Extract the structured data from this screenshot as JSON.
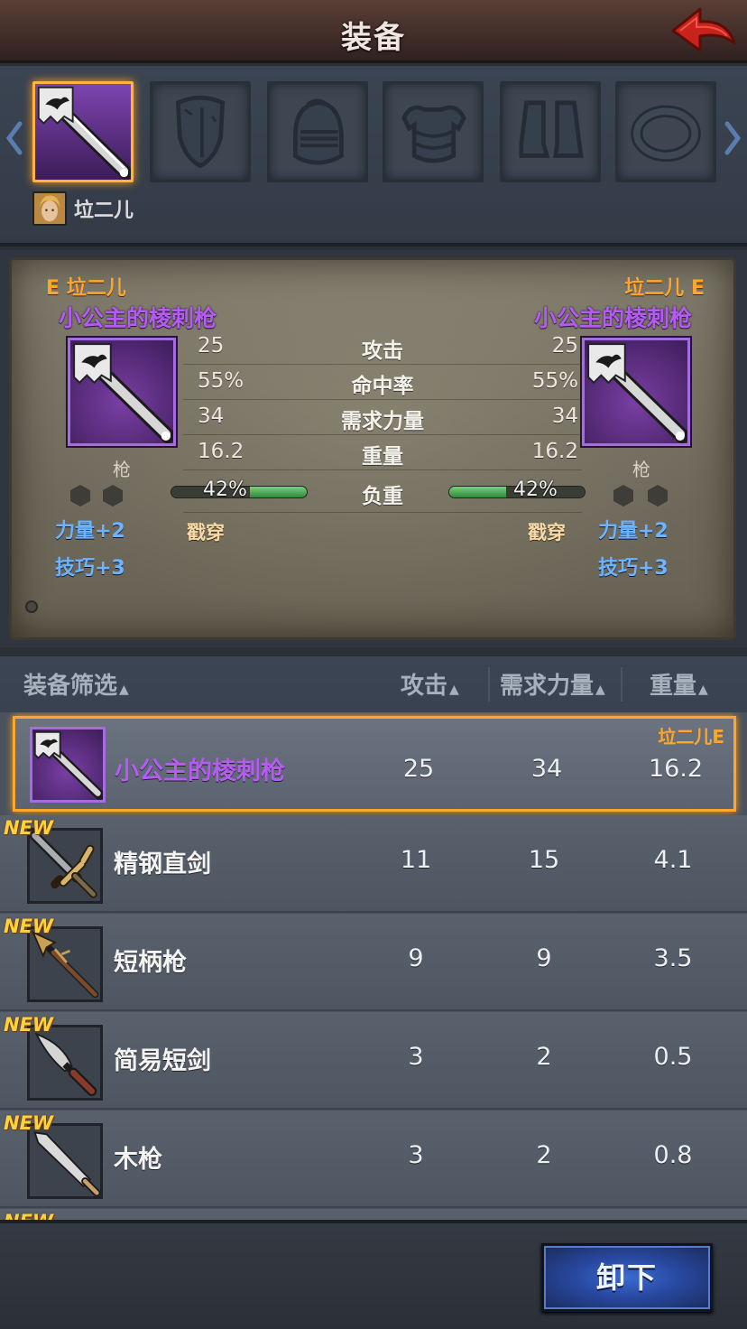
{
  "header": {
    "title": "装备"
  },
  "owner": {
    "name": "垃二儿"
  },
  "slots": [
    {
      "icon": "spear-icon",
      "active": true
    },
    {
      "icon": "shield-icon",
      "active": false
    },
    {
      "icon": "helmet-icon",
      "active": false
    },
    {
      "icon": "armor-icon",
      "active": false
    },
    {
      "icon": "boots-icon",
      "active": false
    },
    {
      "icon": "ring-icon",
      "active": false
    }
  ],
  "compare": {
    "left": {
      "owner": "E 垃二儿",
      "name": "小公主的棱刺枪",
      "type": "枪",
      "bonuses": [
        "力量+2",
        "技巧+3"
      ],
      "trait": "戳穿"
    },
    "right": {
      "owner": "垃二儿 E",
      "name": "小公主的棱刺枪",
      "type": "枪",
      "bonuses": [
        "力量+2",
        "技巧+3"
      ],
      "trait": "戳穿"
    },
    "stats": [
      {
        "label": "攻击",
        "left": "25",
        "right": "25"
      },
      {
        "label": "命中率",
        "left": "55%",
        "right": "55%"
      },
      {
        "label": "需求力量",
        "left": "34",
        "right": "34"
      },
      {
        "label": "重量",
        "left": "16.2",
        "right": "16.2"
      }
    ],
    "load": {
      "label": "负重",
      "left": "42%",
      "right": "42%",
      "left_fraction": 0.42,
      "right_fraction": 0.42
    }
  },
  "filter": {
    "label": "装备筛选",
    "col_attack": "攻击",
    "col_strength": "需求力量",
    "col_weight": "重量"
  },
  "items": [
    {
      "name": "小公主的棱刺枪",
      "attack": "25",
      "strength": "34",
      "weight": "16.2",
      "equipped_by": "垃二儿E",
      "selected": true,
      "new": false,
      "icon": "spear-icon"
    },
    {
      "name": "精钢直剑",
      "attack": "11",
      "strength": "15",
      "weight": "4.1",
      "new_label": "NEW",
      "icon": "sword-icon"
    },
    {
      "name": "短柄枪",
      "attack": "9",
      "strength": "9",
      "weight": "3.5",
      "new_label": "NEW",
      "icon": "short-spear-icon"
    },
    {
      "name": "简易短剑",
      "attack": "3",
      "strength": "2",
      "weight": "0.5",
      "new_label": "NEW",
      "icon": "dagger-icon"
    },
    {
      "name": "木枪",
      "attack": "3",
      "strength": "2",
      "weight": "0.8",
      "new_label": "NEW",
      "icon": "wooden-spear-icon"
    }
  ],
  "partial_new_label": "NEW",
  "footer": {
    "unequip_label": "卸下"
  },
  "colors": {
    "accent_orange": "#ffa52a",
    "epic_purple": "#b45cf2",
    "bonus_blue": "#6db4ff",
    "load_green": "#2f8a3c"
  }
}
